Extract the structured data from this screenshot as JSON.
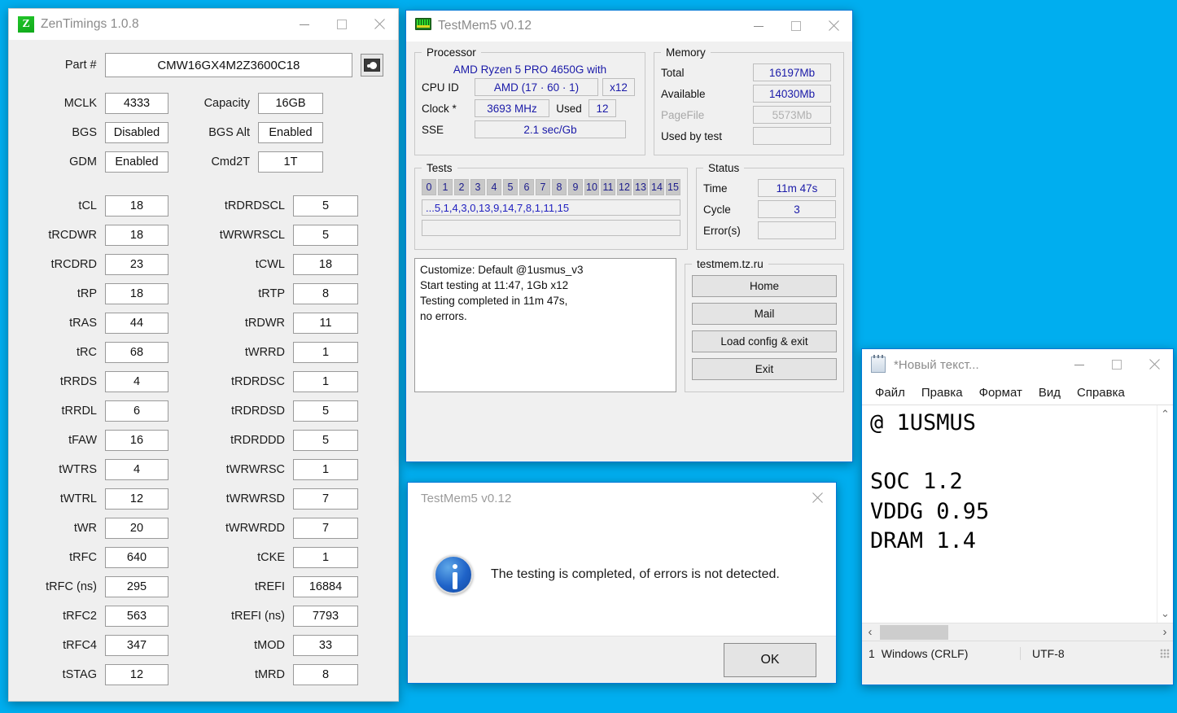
{
  "desktop": {
    "background": "#00AEEF"
  },
  "zentimings": {
    "title": "ZenTimings 1.0.8",
    "icon": "z-logo-icon",
    "logo_letter": "Z",
    "part_label": "Part #",
    "part_value": "CMW16GX4M2Z3600C18",
    "screenshot_button": "camera-icon",
    "header_left": [
      {
        "label": "MCLK",
        "value": "4333"
      },
      {
        "label": "BGS",
        "value": "Disabled"
      },
      {
        "label": "GDM",
        "value": "Enabled"
      }
    ],
    "header_right": [
      {
        "label": "Capacity",
        "value": "16GB"
      },
      {
        "label": "BGS Alt",
        "value": "Enabled"
      },
      {
        "label": "Cmd2T",
        "value": "1T"
      }
    ],
    "timings_left": [
      {
        "label": "tCL",
        "value": "18"
      },
      {
        "label": "tRCDWR",
        "value": "18"
      },
      {
        "label": "tRCDRD",
        "value": "23"
      },
      {
        "label": "tRP",
        "value": "18"
      },
      {
        "label": "tRAS",
        "value": "44"
      },
      {
        "label": "tRC",
        "value": "68"
      },
      {
        "label": "tRRDS",
        "value": "4"
      },
      {
        "label": "tRRDL",
        "value": "6"
      },
      {
        "label": "tFAW",
        "value": "16"
      },
      {
        "label": "tWTRS",
        "value": "4"
      },
      {
        "label": "tWTRL",
        "value": "12"
      },
      {
        "label": "tWR",
        "value": "20"
      },
      {
        "label": "tRFC",
        "value": "640"
      },
      {
        "label": "tRFC (ns)",
        "value": "295"
      },
      {
        "label": "tRFC2",
        "value": "563"
      },
      {
        "label": "tRFC4",
        "value": "347"
      },
      {
        "label": "tSTAG",
        "value": "12"
      }
    ],
    "timings_right": [
      {
        "label": "tRDRDSCL",
        "value": "5"
      },
      {
        "label": "tWRWRSCL",
        "value": "5"
      },
      {
        "label": "tCWL",
        "value": "18"
      },
      {
        "label": "tRTP",
        "value": "8"
      },
      {
        "label": "tRDWR",
        "value": "11"
      },
      {
        "label": "tWRRD",
        "value": "1"
      },
      {
        "label": "tRDRDSC",
        "value": "1"
      },
      {
        "label": "tRDRDSD",
        "value": "5"
      },
      {
        "label": "tRDRDDD",
        "value": "5"
      },
      {
        "label": "tWRWRSC",
        "value": "1"
      },
      {
        "label": "tWRWRSD",
        "value": "7"
      },
      {
        "label": "tWRWRDD",
        "value": "7"
      },
      {
        "label": "tCKE",
        "value": "1"
      },
      {
        "label": "tREFI",
        "value": "16884"
      },
      {
        "label": "tREFI (ns)",
        "value": "7793"
      },
      {
        "label": "tMOD",
        "value": "33"
      },
      {
        "label": "tMRD",
        "value": "8"
      }
    ]
  },
  "testmem": {
    "title": "TestMem5 v0.12",
    "icon": "memory-module-icon",
    "processor": {
      "legend": "Processor",
      "cpu_name": "AMD Ryzen 5 PRO 4650G with",
      "cpuid_label": "CPU ID",
      "cpuid_value": "AMD  (17 · 60 · 1)",
      "threads_value": "x12",
      "clock_label": "Clock *",
      "clock_value": "3693 MHz",
      "used_label": "Used",
      "used_value": "12",
      "sse_label": "SSE",
      "sse_value": "2.1 sec/Gb"
    },
    "memory": {
      "legend": "Memory",
      "total_label": "Total",
      "total_value": "16197Mb",
      "available_label": "Available",
      "available_value": "14030Mb",
      "pagefile_label": "PageFile",
      "pagefile_value": "5573Mb",
      "usedbytest_label": "Used by test",
      "usedbytest_value": ""
    },
    "tests": {
      "legend": "Tests",
      "numbers": [
        "0",
        "1",
        "2",
        "3",
        "4",
        "5",
        "6",
        "7",
        "8",
        "9",
        "10",
        "11",
        "12",
        "13",
        "14",
        "15"
      ],
      "sequence": "...5,1,4,3,0,13,9,14,7,8,1,11,15",
      "second_line": ""
    },
    "status": {
      "legend": "Status",
      "time_label": "Time",
      "time_value": "11m 47s",
      "cycle_label": "Cycle",
      "cycle_value": "3",
      "errors_label": "Error(s)",
      "errors_value": ""
    },
    "log": "Customize: Default @1usmus_v3\nStart testing at 11:47, 1Gb x12\nTesting completed in 11m 47s,\nno errors.",
    "links": {
      "legend": "testmem.tz.ru",
      "buttons": [
        "Home",
        "Mail",
        "Load config & exit",
        "Exit"
      ]
    }
  },
  "dialog": {
    "title": "TestMem5 v0.12",
    "icon": "info-icon",
    "message": "The testing is completed, of errors is not detected.",
    "ok_label": "OK"
  },
  "notepad": {
    "title": "*Новый текст...",
    "icon": "notepad-icon",
    "menu": [
      "Файл",
      "Правка",
      "Формат",
      "Вид",
      "Справка"
    ],
    "content": "@ 1USMUS\n\nSOC 1.2\nVDDG 0.95\nDRAM 1.4",
    "status": {
      "line_number": "1",
      "line_ending": "Windows (CRLF)",
      "encoding": "UTF-8"
    },
    "scroll_up": "⌃",
    "scroll_down": "⌄",
    "scroll_left": "‹",
    "scroll_right": "›"
  }
}
